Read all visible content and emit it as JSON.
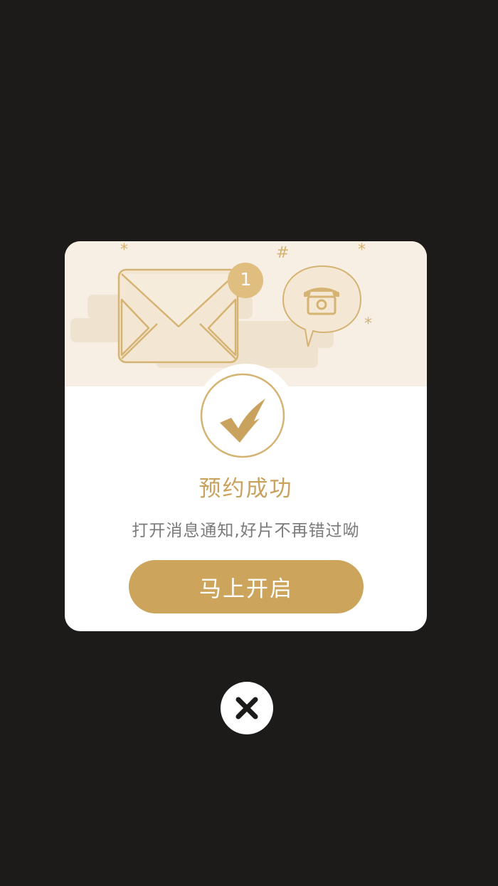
{
  "dialog": {
    "badge_count": "1",
    "title": "预约成功",
    "subtitle": "打开消息通知,好片不再错过呦",
    "button_label": "马上开启",
    "decor_symbols": [
      "*",
      "#",
      "*",
      "*"
    ]
  },
  "icons": {
    "envelope": "envelope-icon",
    "phone_bubble": "phone-bubble-icon",
    "check": "check-icon",
    "close": "close-icon"
  },
  "colors": {
    "background": "#1c1b1a",
    "accent": "#cca45c",
    "title": "#c9a25e",
    "banner": "#f7efe4",
    "subtitle": "#7a7a7a"
  }
}
